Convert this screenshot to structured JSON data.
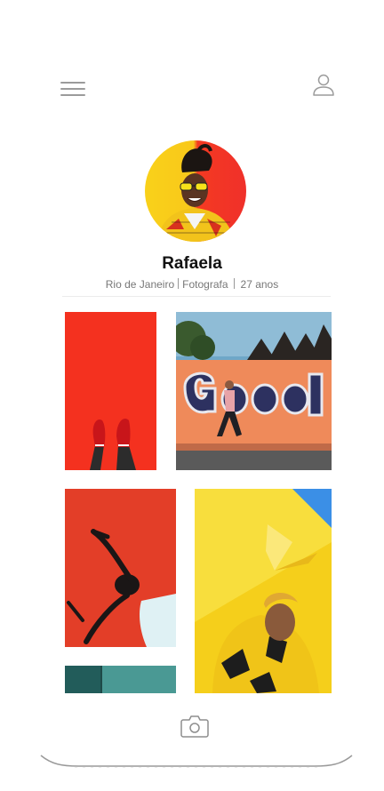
{
  "header": {
    "menu_icon": "hamburger-menu-icon",
    "profile_icon": "user-icon"
  },
  "profile": {
    "name": "Rafaela",
    "city": "Rio de Janeiro",
    "profession": "Fotografa",
    "age": "27 anos"
  },
  "gallery": {
    "photos": [
      {
        "subject": "red-sneakers-on-red-background"
      },
      {
        "subject": "graffiti-good-wall"
      },
      {
        "subject": "woman-against-red-wall"
      },
      {
        "subject": "man-yellow-jacket-yellow-wall"
      },
      {
        "subject": "teal-building"
      }
    ]
  },
  "footer": {
    "camera_icon": "camera-icon"
  },
  "colors": {
    "accent_red": "#f4311f",
    "accent_yellow": "#f7d21a",
    "text": "#111111",
    "muted": "#777777"
  }
}
